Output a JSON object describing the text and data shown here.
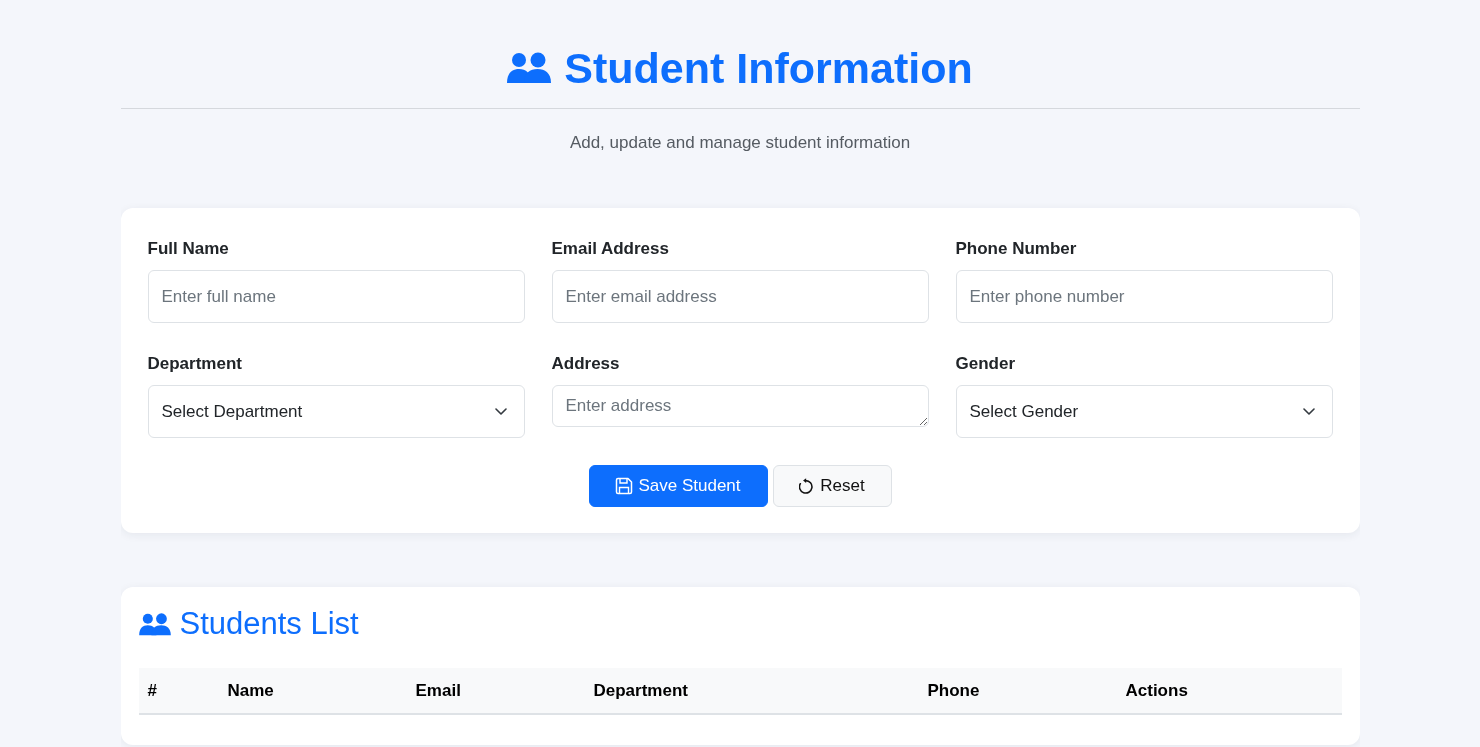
{
  "header": {
    "title": "Student Information",
    "subtitle": "Add, update and manage student information"
  },
  "form": {
    "fields": [
      {
        "kind": "input",
        "label": "Full Name",
        "placeholder": "Enter full name"
      },
      {
        "kind": "input",
        "label": "Email Address",
        "placeholder": "Enter email address"
      },
      {
        "kind": "input",
        "label": "Phone Number",
        "placeholder": "Enter phone number"
      },
      {
        "kind": "select",
        "label": "Department",
        "value": "Select Department"
      },
      {
        "kind": "textarea",
        "label": "Address",
        "placeholder": "Enter address"
      },
      {
        "kind": "select",
        "label": "Gender",
        "value": "Select Gender"
      }
    ],
    "buttons": [
      {
        "kind": "primary",
        "label": "Save Student"
      },
      {
        "kind": "secondary",
        "label": "Reset"
      }
    ]
  },
  "students_list": {
    "title": "Students List",
    "table": {
      "columns": [
        "#",
        "Name",
        "Email",
        "Department",
        "Phone",
        "Actions"
      ]
    }
  }
}
